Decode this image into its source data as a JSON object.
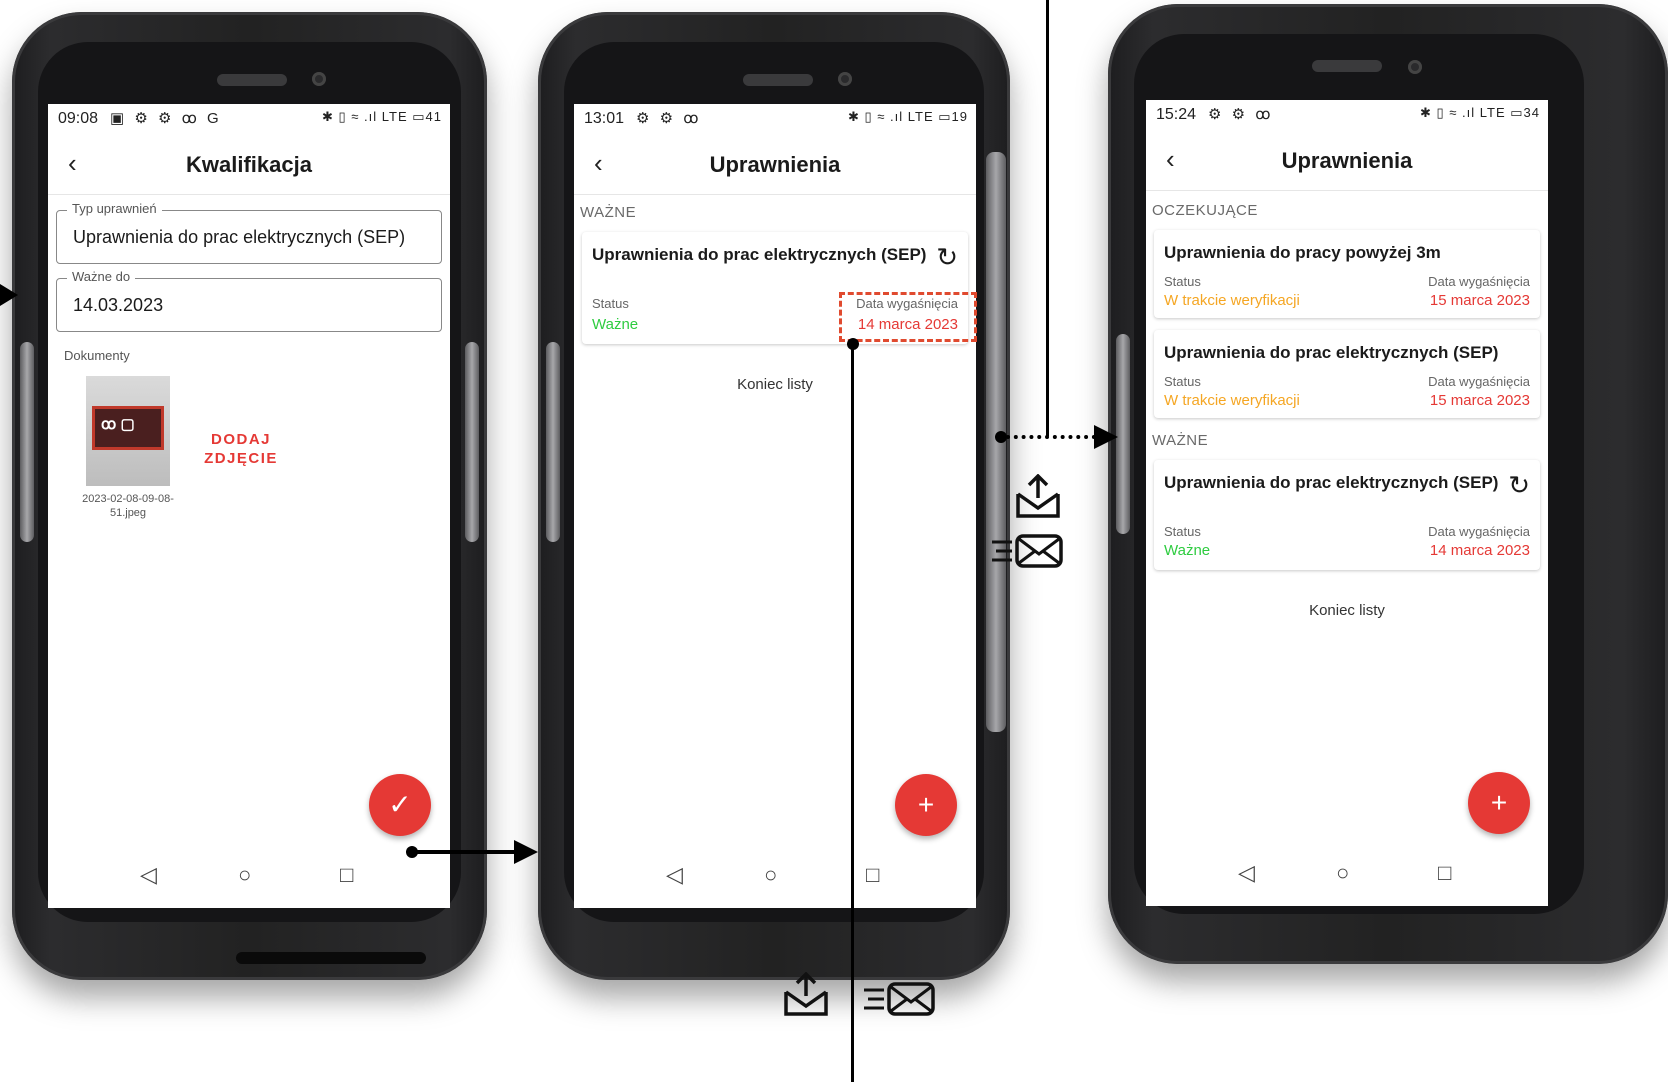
{
  "screens": [
    {
      "status_time": "09:08",
      "status_icons_left": "▣ ⚙ ⚙ ꝏ G",
      "status_icons_right": "✱ ▯ ≈ .ıl LTE ▭41",
      "title": "Kwalifikacja",
      "fields": [
        {
          "label": "Typ uprawnień",
          "value": "Uprawnienia do prac elektrycznych (SEP)"
        },
        {
          "label": "Ważne do",
          "value": "14.03.2023"
        }
      ],
      "documents_label": "Dokumenty",
      "document_caption": "2023-02-08-09-08-51.jpeg",
      "add_photo_label": "DODAJ ZDJĘCIE",
      "fab_icon": "✓"
    },
    {
      "status_time": "13:01",
      "status_icons_left": "⚙ ⚙ ꝏ",
      "status_icons_right": "✱ ▯ ≈ .ıl LTE ▭19",
      "title": "Uprawnienia",
      "section_valid": "WAŻNE",
      "card": {
        "title": "Uprawnienia do prac elektrycznych (SEP)",
        "status_label": "Status",
        "status_value": "Ważne",
        "date_label": "Data wygaśnięcia",
        "date_value": "14 marca 2023"
      },
      "end_of_list": "Koniec listy",
      "fab_icon": "+"
    },
    {
      "status_time": "15:24",
      "status_icons_left": "⚙ ⚙ ꝏ",
      "status_icons_right": "✱ ▯ ≈ .ıl LTE ▭34",
      "title": "Uprawnienia",
      "section_pending": "OCZEKUJĄCE",
      "pending_cards": [
        {
          "title": "Uprawnienia do pracy powyżej 3m",
          "status_label": "Status",
          "status_value": "W trakcie weryfikacji",
          "date_label": "Data wygaśnięcia",
          "date_value": "15 marca 2023"
        },
        {
          "title": "Uprawnienia do prac elektrycznych (SEP)",
          "status_label": "Status",
          "status_value": "W trakcie weryfikacji",
          "date_label": "Data wygaśnięcia",
          "date_value": "15 marca 2023"
        }
      ],
      "section_valid": "WAŻNE",
      "valid_card": {
        "title": "Uprawnienia do prac elektrycznych (SEP)",
        "status_label": "Status",
        "status_value": "Ważne",
        "date_label": "Data wygaśnięcia",
        "date_value": "14 marca 2023"
      },
      "end_of_list": "Koniec listy",
      "fab_icon": "+"
    }
  ],
  "nav": {
    "back": "◁",
    "home": "○",
    "recent": "□"
  },
  "colors": {
    "accent": "#e53935",
    "valid": "#2ecc40",
    "pending": "#f5a623"
  },
  "icons": {
    "appbar_back": "chevron-left-icon",
    "refresh": "refresh-icon",
    "upload_mail": "mail-upload-icon",
    "fast_mail": "fast-mail-icon"
  }
}
